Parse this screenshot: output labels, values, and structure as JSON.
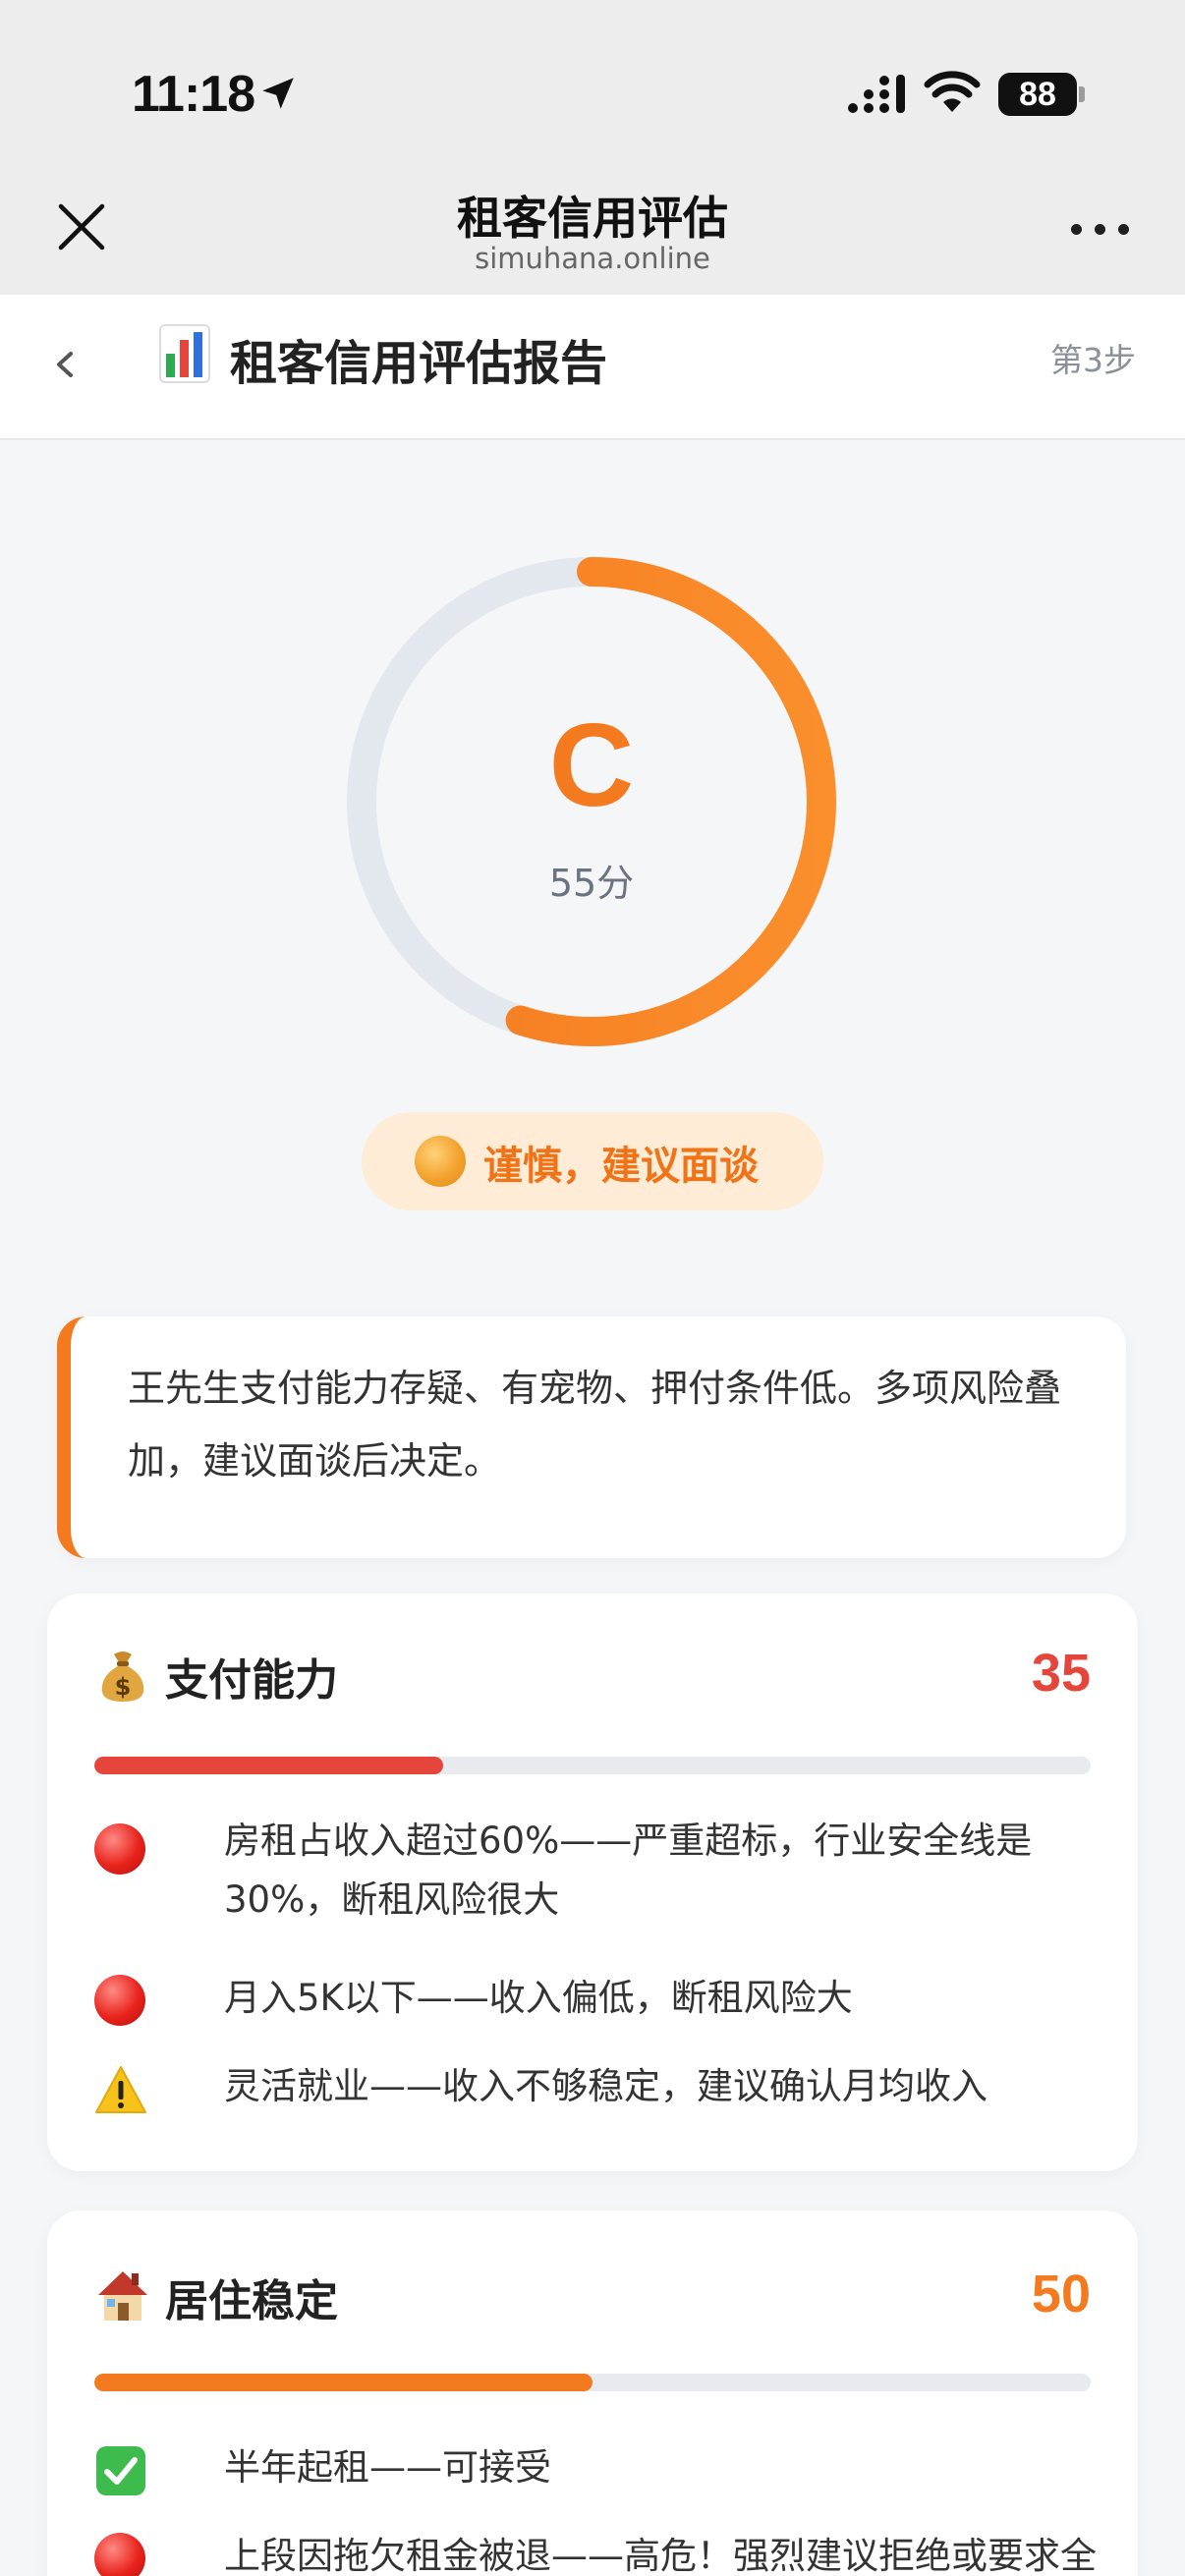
{
  "status_bar": {
    "time": "11:18",
    "battery": "88"
  },
  "webview": {
    "title": "租客信用评估",
    "url": "simuhana.online"
  },
  "page": {
    "title": "租客信用评估报告",
    "step": "第3步"
  },
  "grade": {
    "letter": "C",
    "score_text": "55分",
    "score": 55,
    "max": 100
  },
  "verdict": {
    "text": "谨慎，建议面谈"
  },
  "summary": {
    "text": "王先生支付能力存疑、有宠物、押付条件低。多项风险叠加，建议面谈后决定。"
  },
  "sections": [
    {
      "title": "支付能力",
      "score": "35",
      "score_value": 35,
      "color": "#e5453b",
      "items": [
        {
          "icon": "red-circle-icon",
          "text": "房租占收入超过60%——严重超标，行业安全线是30%，断租风险很大"
        },
        {
          "icon": "red-circle-icon",
          "text": "月入5K以下——收入偏低，断租风险大"
        },
        {
          "icon": "warning-icon",
          "text": "灵活就业——收入不够稳定，建议确认月均收入"
        }
      ]
    },
    {
      "title": "居住稳定",
      "score": "50",
      "score_value": 50,
      "color": "#f47a20",
      "items": [
        {
          "icon": "check-icon",
          "text": "半年起租——可接受"
        },
        {
          "icon": "red-circle-icon",
          "text": "上段因拖欠租金被退——高危！强烈建议拒绝或要求全"
        }
      ]
    }
  ],
  "colors": {
    "accent": "#f47a20",
    "danger": "#e5453b",
    "track": "#e7eaef"
  }
}
